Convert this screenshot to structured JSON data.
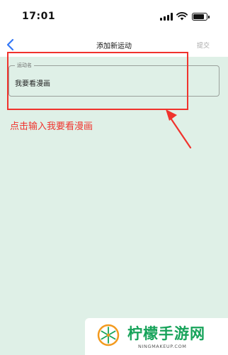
{
  "status_bar": {
    "time": "17:01"
  },
  "nav": {
    "title": "添加新运动",
    "submit_label": "提交"
  },
  "form": {
    "field_label": "运动名",
    "field_value": "我要看漫画"
  },
  "annotation": {
    "instruction": "点击输入我要看漫画",
    "color": "#f0332d"
  },
  "watermark": {
    "title": "柠檬手游网",
    "subtitle": "NINGMAKEUP.COM"
  },
  "colors": {
    "background": "#dff0e7",
    "accent": "#3478f6",
    "brand": "#17a35a"
  }
}
